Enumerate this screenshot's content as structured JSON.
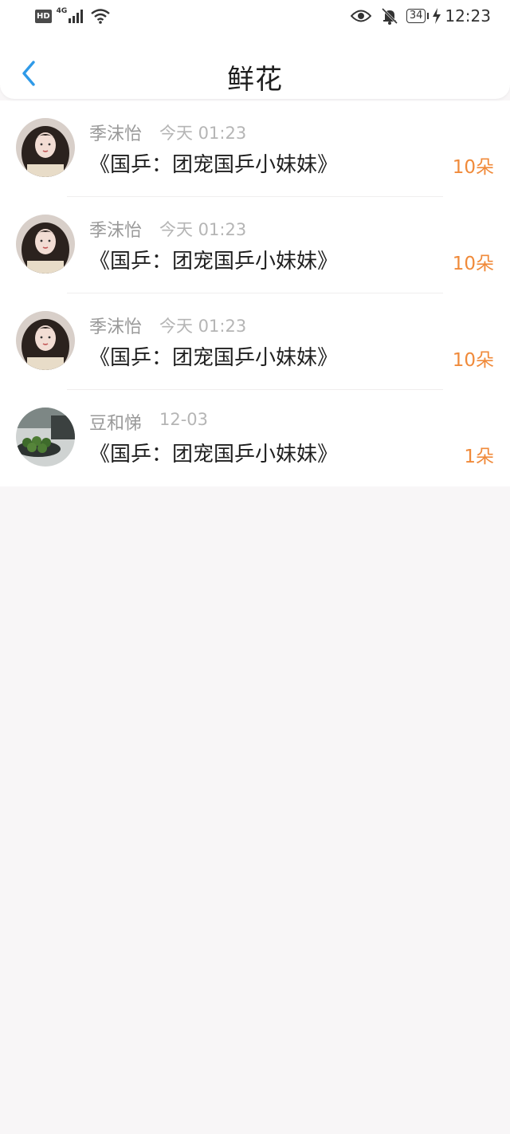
{
  "status_bar": {
    "hd": "HD",
    "network": "4G",
    "battery": "34",
    "time": "12:23",
    "icons": [
      "signal-icon",
      "wifi-icon",
      "eye-icon",
      "bell-off-icon",
      "battery-icon",
      "charging-icon"
    ]
  },
  "header": {
    "title": "鲜花",
    "back_icon": "chevron-left-icon",
    "accent": "#2f9ae8"
  },
  "list": {
    "count_color": "#f08a3a",
    "items": [
      {
        "name": "季沫怡",
        "time": "今天 01:23",
        "book": "《国乒：团宠国乒小妹妹》",
        "count": "10朵",
        "avatar": "girl-avatar"
      },
      {
        "name": "季沫怡",
        "time": "今天 01:23",
        "book": "《国乒：团宠国乒小妹妹》",
        "count": "10朵",
        "avatar": "girl-avatar"
      },
      {
        "name": "季沫怡",
        "time": "今天 01:23",
        "book": "《国乒：团宠国乒小妹妹》",
        "count": "10朵",
        "avatar": "girl-avatar"
      },
      {
        "name": "豆和悌",
        "time": "12-03",
        "book": "《国乒：团宠国乒小妹妹》",
        "count": "1朵",
        "avatar": "fruit-bowl-avatar"
      }
    ]
  }
}
